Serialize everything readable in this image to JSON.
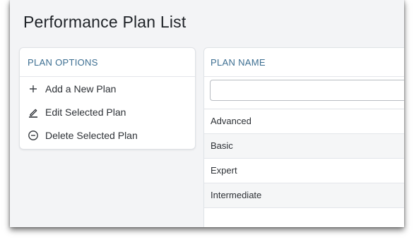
{
  "page": {
    "title": "Performance Plan List"
  },
  "plan_options": {
    "header": "PLAN OPTIONS",
    "items": [
      {
        "label": "Add a New Plan",
        "icon": "plus-icon"
      },
      {
        "label": "Edit Selected Plan",
        "icon": "pencil-icon"
      },
      {
        "label": "Delete Selected Plan",
        "icon": "minus-circle-icon"
      }
    ]
  },
  "plan_list": {
    "column_header": "PLAN NAME",
    "filter": {
      "value": "",
      "placeholder": ""
    },
    "rows": [
      "Advanced",
      "Basic",
      "Expert",
      "Intermediate"
    ]
  },
  "colors": {
    "accent_text": "#3d6f92",
    "background": "#f3f4f6"
  }
}
